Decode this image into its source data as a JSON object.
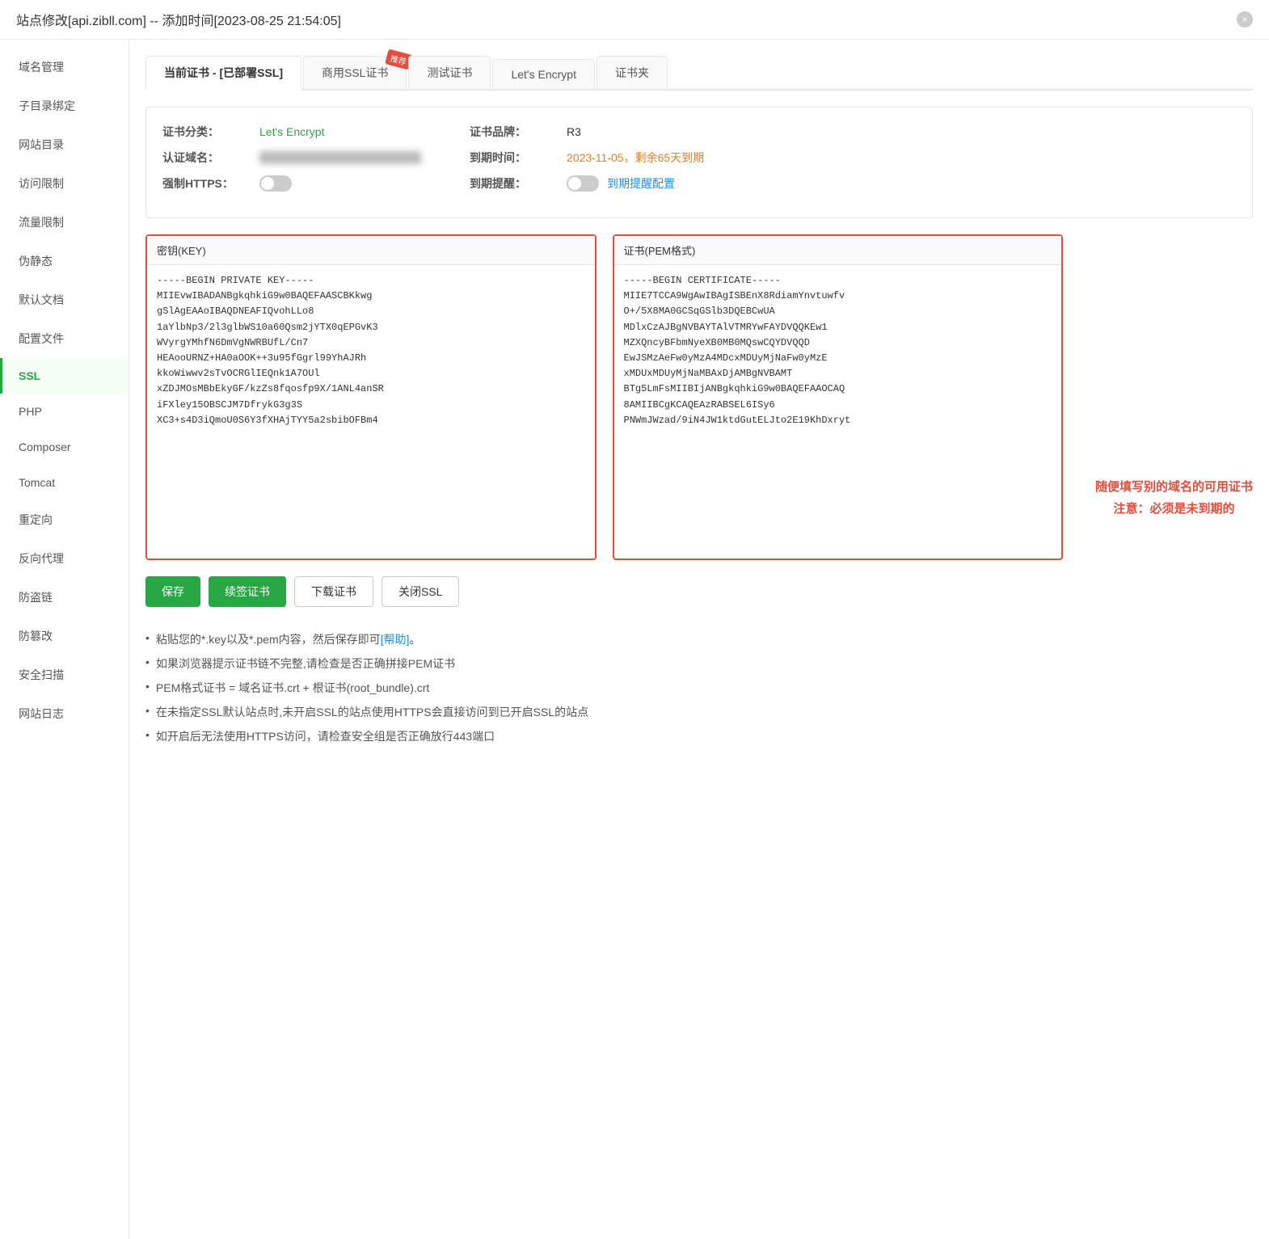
{
  "titleBar": {
    "title": "站点修改[api.zibll.com] -- 添加时间[2023-08-25 21:54:05]",
    "closeLabel": "×"
  },
  "sidebar": {
    "items": [
      {
        "id": "domain",
        "label": "域名管理",
        "active": false
      },
      {
        "id": "subdir",
        "label": "子目录绑定",
        "active": false
      },
      {
        "id": "website-dir",
        "label": "网站目录",
        "active": false
      },
      {
        "id": "access-control",
        "label": "访问限制",
        "active": false
      },
      {
        "id": "traffic-limit",
        "label": "流量限制",
        "active": false
      },
      {
        "id": "pseudo-static",
        "label": "伪静态",
        "active": false
      },
      {
        "id": "default-doc",
        "label": "默认文档",
        "active": false
      },
      {
        "id": "config-file",
        "label": "配置文件",
        "active": false
      },
      {
        "id": "ssl",
        "label": "SSL",
        "active": true
      },
      {
        "id": "php",
        "label": "PHP",
        "active": false
      },
      {
        "id": "composer",
        "label": "Composer",
        "active": false
      },
      {
        "id": "tomcat",
        "label": "Tomcat",
        "active": false
      },
      {
        "id": "redirect",
        "label": "重定向",
        "active": false
      },
      {
        "id": "reverse-proxy",
        "label": "反向代理",
        "active": false
      },
      {
        "id": "anti-theft",
        "label": "防盗链",
        "active": false
      },
      {
        "id": "anti-tamper",
        "label": "防篡改",
        "active": false
      },
      {
        "id": "security-scan",
        "label": "安全扫描",
        "active": false
      },
      {
        "id": "website-log",
        "label": "网站日志",
        "active": false
      }
    ]
  },
  "tabs": [
    {
      "id": "current-cert",
      "label": "当前证书 - [已部署SSL]",
      "active": true,
      "badge": ""
    },
    {
      "id": "commercial-ssl",
      "label": "商用SSL证书",
      "active": false,
      "badge": "推荐"
    },
    {
      "id": "test-cert",
      "label": "测试证书",
      "active": false,
      "badge": ""
    },
    {
      "id": "lets-encrypt",
      "label": "Let's Encrypt",
      "active": false,
      "badge": ""
    },
    {
      "id": "cert-folder",
      "label": "证书夹",
      "active": false,
      "badge": ""
    }
  ],
  "certInfo": {
    "classLabel": "证书分类：",
    "classValue": "Let's Encrypt",
    "brandLabel": "证书品牌：",
    "brandValue": "R3",
    "domainLabel": "认证域名：",
    "domainValue": "（已遮蔽）",
    "expiryLabel": "到期时间：",
    "expiryValue": "2023-11-05，剩余65天到期",
    "forceHttpsLabel": "强制HTTPS：",
    "expiryReminderLabel": "到期提醒：",
    "expiryReminderLinkLabel": "到期提醒配置"
  },
  "keyBox": {
    "title": "密钥(KEY)",
    "content": "-----BEGIN PRIVATE KEY-----\nMIIEvwIBADANBgkqhkiG9w0BAQEFAASCBKkwg\ngSlAgEAAoIBAQDNEAFIQvohLLo8\n1aYlbNp3/2l3glbWS10a60Qsm2jYTX0qEPGvK3\nWVyrgYMhfN6DmVgNWRBUfL/Cn7\nHEAooURNZ+HA0aOOK++3u95fGgrl99YhAJRh\nkkoWiwwv2sTvOCRGlIEQnk1A7OUl\nxZDJMOsMBbEkyGF/kzZs8fqosfp9X/1ANL4anSR\niFXley15OBSCJM7DfrykG3g3S\nXC3+s4D3iQmoU0S6Y3fXHAjTYY5a2sbibOFBm4"
  },
  "certBox": {
    "title": "证书(PEM格式)",
    "content": "-----BEGIN CERTIFICATE-----\nMIIE7TCCA9WgAwIBAgISBEnX8RdiamYnvtuwfv\nO+/5X8MA0GCSqGSlb3DQEBCwUA\nMDlxCzAJBgNVBAYTAlVTMRYwFAYDVQQKEw1\nMZXQncyBFbmNyeXB0MB0MQswCQYDVQQD\nEwJSMzAeFw0yMzA4MDcxMDUyMjNaFw0yMzE\nxMDUxMDUyMjNaMBAxDjAMBgNVBAMT\nBTg5LmFsMIIBIjANBgkqhkiG9w0BAQEFAAOCAQ\n8AMIIBCgKCAQEAzRABSEL6ISy6\nPNWmJWzad/9iN4JW1ktdGutELJto2E19KhDxryt"
  },
  "buttons": {
    "save": "保存",
    "renewCert": "续签证书",
    "downloadCert": "下载证书",
    "closeSSL": "关闭SSL"
  },
  "tips": [
    {
      "text": "粘贴您的*.key以及*.pem内容，然后保存即可",
      "link": "[帮助]",
      "linkAfter": "。"
    },
    {
      "text": "如果浏览器提示证书链不完整,请检查是否正确拼接PEM证书",
      "link": "",
      "linkAfter": ""
    },
    {
      "text": "PEM格式证书 = 域名证书.crt + 根证书(root_bundle).crt",
      "link": "",
      "linkAfter": ""
    },
    {
      "text": "在未指定SSL默认站点时,未开启SSL的站点使用HTTPS会直接访问到已开启SSL的站点",
      "link": "",
      "linkAfter": ""
    },
    {
      "text": "如开启后无法使用HTTPS访问，请检查安全组是否正确放行443端口",
      "link": "",
      "linkAfter": ""
    }
  ],
  "redNotice": {
    "line1": "随便填写别的域名的可用证书",
    "line2": "注意：必须是未到期的"
  }
}
